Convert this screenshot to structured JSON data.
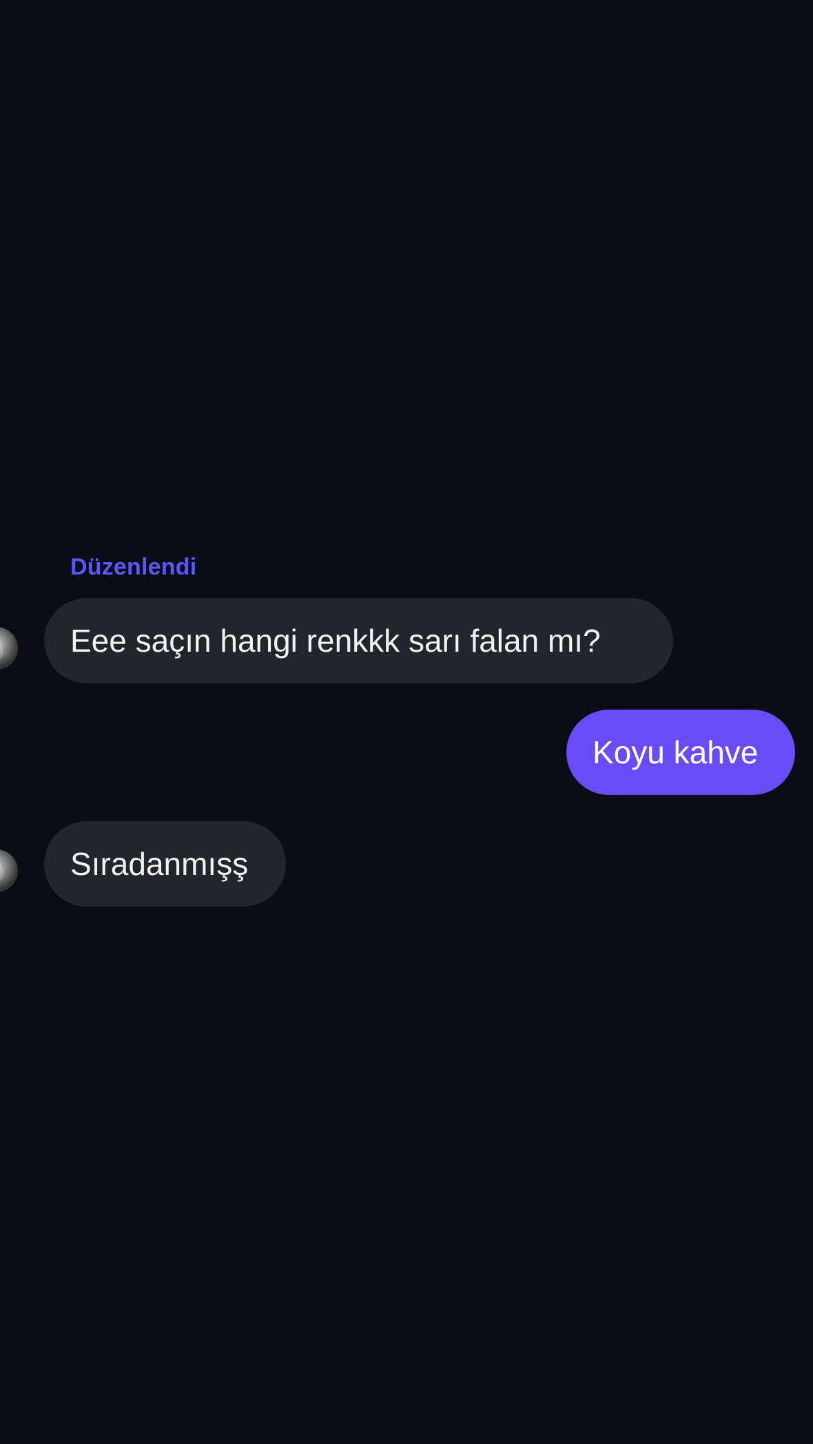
{
  "chat": {
    "edited_label": "Düzenlendi",
    "messages": [
      {
        "direction": "incoming",
        "text": "Eee saçın hangi renkkk sarı falan mı?"
      },
      {
        "direction": "outgoing",
        "text": "Koyu kahve"
      },
      {
        "direction": "incoming",
        "text": "Sıradanmışş"
      }
    ]
  },
  "colors": {
    "background": "#0a0d15",
    "incoming_bubble": "#22252c",
    "outgoing_bubble": "#6a4cf6",
    "edited_label": "#5b57f4",
    "text": "#f2f2f4"
  }
}
